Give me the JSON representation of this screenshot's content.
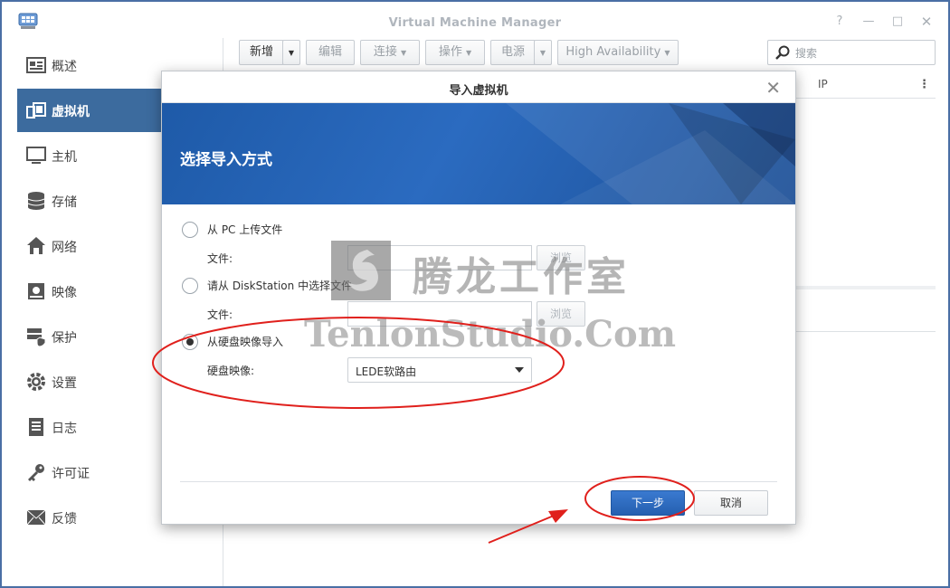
{
  "window": {
    "title": "Virtual Machine Manager",
    "controls": [
      "?",
      "—",
      "□",
      "✕"
    ]
  },
  "sidebar": {
    "items": [
      {
        "label": "概述",
        "icon": "overview-icon",
        "active": false
      },
      {
        "label": "虚拟机",
        "icon": "virtual-machine-icon",
        "active": true
      },
      {
        "label": "主机",
        "icon": "host-icon",
        "active": false
      },
      {
        "label": "存储",
        "icon": "storage-icon",
        "active": false
      },
      {
        "label": "网络",
        "icon": "network-icon",
        "active": false
      },
      {
        "label": "映像",
        "icon": "image-icon",
        "active": false
      },
      {
        "label": "保护",
        "icon": "protection-icon",
        "active": false
      },
      {
        "label": "设置",
        "icon": "gear-icon",
        "active": false
      },
      {
        "label": "日志",
        "icon": "log-icon",
        "active": false
      },
      {
        "label": "许可证",
        "icon": "key-icon",
        "active": false
      },
      {
        "label": "反馈",
        "icon": "mail-icon",
        "active": false
      }
    ]
  },
  "toolbar": {
    "create": "新增",
    "edit": "编辑",
    "connect": "连接",
    "action": "操作",
    "power": "电源",
    "ha": "High Availability"
  },
  "search": {
    "placeholder": "搜索"
  },
  "grid": {
    "column_ip": "IP"
  },
  "dialog": {
    "title": "导入虚拟机",
    "heading": "选择导入方式",
    "options": [
      {
        "label": "从 PC 上传文件",
        "checked": false
      },
      {
        "label": "请从 DiskStation 中选择文件",
        "checked": false
      },
      {
        "label": "从硬盘映像导入",
        "checked": true
      }
    ],
    "file_label": "文件:",
    "browse_label": "浏览",
    "disk_image_label": "硬盘映像:",
    "disk_image_value": "LEDE软路由",
    "next_label": "下一步",
    "cancel_label": "取消"
  },
  "watermark": {
    "cn": "腾龙工作室",
    "en": "TenlonStudio.Com"
  },
  "colors": {
    "accent": "#3c6b9e",
    "primary_button": "#2b6bc0",
    "annotation": "#e0201c"
  }
}
